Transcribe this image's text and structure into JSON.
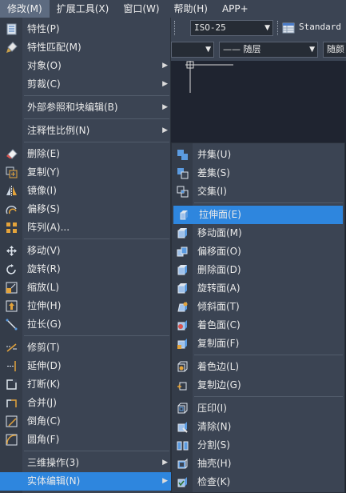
{
  "menubar": {
    "items": [
      "修改(M)",
      "扩展工具(X)",
      "窗口(W)",
      "帮助(H)",
      "APP+"
    ]
  },
  "toolbar": {
    "dimstyle": "ISO-25",
    "tablestyle": "Standard",
    "linetype": "—— 随层",
    "lineweight": "随颜"
  },
  "modify_menu": [
    {
      "label": "特性(P)",
      "icon": "properties-icon"
    },
    {
      "label": "特性匹配(M)",
      "icon": "match-properties-icon"
    },
    {
      "label": "对象(O)",
      "submenu": true
    },
    {
      "label": "剪裁(C)",
      "submenu": true
    },
    {
      "label": "外部参照和块编辑(B)",
      "submenu": true
    },
    {
      "label": "注释性比例(N)",
      "submenu": true
    },
    {
      "label": "删除(E)",
      "icon": "erase-icon"
    },
    {
      "label": "复制(Y)",
      "icon": "copy-icon"
    },
    {
      "label": "镜像(I)",
      "icon": "mirror-icon"
    },
    {
      "label": "偏移(S)",
      "icon": "offset-icon"
    },
    {
      "label": "阵列(A)...",
      "icon": "array-icon"
    },
    {
      "label": "移动(V)",
      "icon": "move-icon"
    },
    {
      "label": "旋转(R)",
      "icon": "rotate-icon"
    },
    {
      "label": "缩放(L)",
      "icon": "scale-icon"
    },
    {
      "label": "拉伸(H)",
      "icon": "stretch-icon"
    },
    {
      "label": "拉长(G)",
      "icon": "lengthen-icon"
    },
    {
      "label": "修剪(T)",
      "icon": "trim-icon"
    },
    {
      "label": "延伸(D)",
      "icon": "extend-icon"
    },
    {
      "label": "打断(K)",
      "icon": "break-icon"
    },
    {
      "label": "合并(J)",
      "icon": "join-icon"
    },
    {
      "label": "倒角(C)",
      "icon": "chamfer-icon"
    },
    {
      "label": "圆角(F)",
      "icon": "fillet-icon"
    },
    {
      "label": "三维操作(3)",
      "submenu": true
    },
    {
      "label": "实体编辑(N)",
      "submenu": true,
      "highlighted": true
    }
  ],
  "solid_edit_menu": [
    {
      "label": "并集(U)",
      "icon": "union-icon"
    },
    {
      "label": "差集(S)",
      "icon": "subtract-icon"
    },
    {
      "label": "交集(I)",
      "icon": "intersect-icon"
    },
    {
      "label": "拉伸面(E)",
      "icon": "extrude-face-icon",
      "highlighted": true
    },
    {
      "label": "移动面(M)",
      "icon": "move-face-icon"
    },
    {
      "label": "偏移面(O)",
      "icon": "offset-face-icon"
    },
    {
      "label": "删除面(D)",
      "icon": "delete-face-icon"
    },
    {
      "label": "旋转面(A)",
      "icon": "rotate-face-icon"
    },
    {
      "label": "倾斜面(T)",
      "icon": "taper-face-icon"
    },
    {
      "label": "着色面(C)",
      "icon": "color-face-icon"
    },
    {
      "label": "复制面(F)",
      "icon": "copy-face-icon"
    },
    {
      "label": "着色边(L)",
      "icon": "color-edge-icon"
    },
    {
      "label": "复制边(G)",
      "icon": "copy-edge-icon"
    },
    {
      "label": "压印(I)",
      "icon": "imprint-icon"
    },
    {
      "label": "清除(N)",
      "icon": "clean-icon"
    },
    {
      "label": "分割(S)",
      "icon": "separate-icon"
    },
    {
      "label": "抽壳(H)",
      "icon": "shell-icon"
    },
    {
      "label": "检查(K)",
      "icon": "check-icon"
    }
  ],
  "colors": {
    "menu_bg": "#3b4453",
    "highlight": "#2e86de",
    "drawing_bg": "#1f2430"
  }
}
